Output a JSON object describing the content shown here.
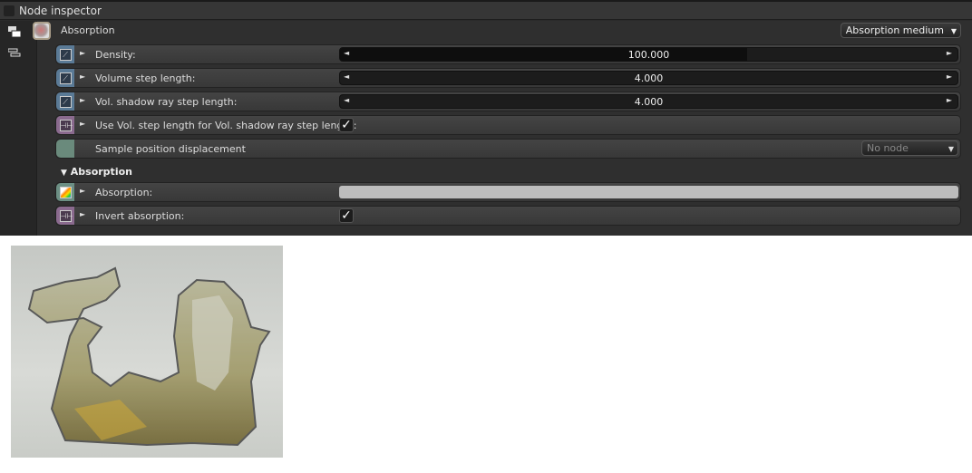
{
  "panel": {
    "title": "Node inspector"
  },
  "node": {
    "name": "Absorption",
    "type_dropdown": "Absorption medium"
  },
  "rows": [
    {
      "label": "Density:",
      "value": "100.000",
      "fill": 0.66
    },
    {
      "label": "Volume step length:",
      "value": "4.000",
      "fill": 0
    },
    {
      "label": "Vol. shadow ray step length:",
      "value": "4.000",
      "fill": 0
    },
    {
      "label": "Use Vol. step length for Vol. shadow ray step length:",
      "checked": true
    },
    {
      "label": "Sample position displacement",
      "dropdown": "No node"
    }
  ],
  "section": {
    "title": "Absorption",
    "collapse_glyph": "▼"
  },
  "absorption_rows": [
    {
      "label": "Absorption:",
      "color": "#bdbdbd"
    },
    {
      "label": "Invert absorption:",
      "checked": true
    }
  ],
  "glyphs": {
    "expand": "►",
    "left": "◄",
    "right": "►",
    "check": "✓",
    "dropdown": "▼"
  }
}
